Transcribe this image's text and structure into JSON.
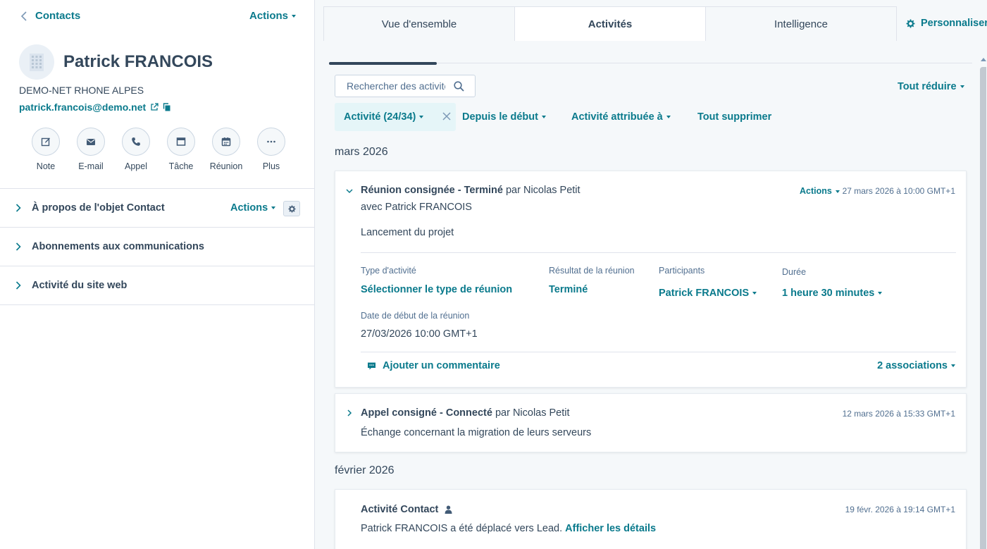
{
  "left": {
    "back_label": "Contacts",
    "actions_label": "Actions",
    "name": "Patrick FRANCOIS",
    "company": "DEMO-NET RHONE ALPES",
    "email": "patrick.francois@demo.net",
    "quick_actions": [
      "Note",
      "E-mail",
      "Appel",
      "Tâche",
      "Réunion",
      "Plus"
    ],
    "sections": [
      {
        "title": "À propos de l'objet Contact",
        "actions": "Actions"
      },
      {
        "title": "Abonnements aux communications"
      },
      {
        "title": "Activité du site web"
      }
    ]
  },
  "tabs": [
    "Vue d'ensemble",
    "Activités",
    "Intelligence"
  ],
  "personalize_label": "Personnaliser",
  "toolbar": {
    "search_placeholder": "Rechercher des activités",
    "collapse_all": "Tout réduire",
    "filter_activity": "Activité (24/34)",
    "filter_since": "Depuis le début",
    "filter_assigned": "Activité attribuée à",
    "clear_all": "Tout supprimer"
  },
  "groups": [
    {
      "month": "mars 2026",
      "items": [
        {
          "title": "Réunion consignée - Terminé",
          "by_prefix": " par ",
          "by": "Nicolas Petit",
          "with": "avec Patrick FRANCOIS",
          "actions": "Actions",
          "timestamp": "27 mars 2026 à 10:00 GMT+1",
          "body": "Lancement du projet",
          "fields": {
            "type_label": "Type d'activité",
            "type_value": "Sélectionner le type de réunion",
            "result_label": "Résultat de la réunion",
            "result_value": "Terminé",
            "participants_label": "Participants",
            "participants_value": "Patrick FRANCOIS",
            "duration_label": "Durée",
            "duration_value": "1 heure 30 minutes",
            "start_label": "Date de début de la réunion",
            "start_value": "27/03/2026 10:00 GMT+1"
          },
          "comment_label": "Ajouter un commentaire",
          "associations_label": "2 associations"
        },
        {
          "title": "Appel consigné - Connecté",
          "by_prefix": " par ",
          "by": "Nicolas Petit",
          "timestamp": "12 mars 2026 à 15:33 GMT+1",
          "body": "Échange concernant la migration de leurs serveurs"
        }
      ]
    },
    {
      "month": "février 2026",
      "items": [
        {
          "title": "Activité Contact",
          "timestamp": "19 févr. 2026 à 19:14 GMT+1",
          "body": "Patrick FRANCOIS a été déplacé vers Lead.",
          "link": "Afficher les détails"
        }
      ]
    }
  ],
  "colors": {
    "accent": "#0a7a8c",
    "text": "#33475b",
    "muted": "#516f90",
    "border": "#dfe3eb",
    "bg": "#f5f8fa"
  }
}
